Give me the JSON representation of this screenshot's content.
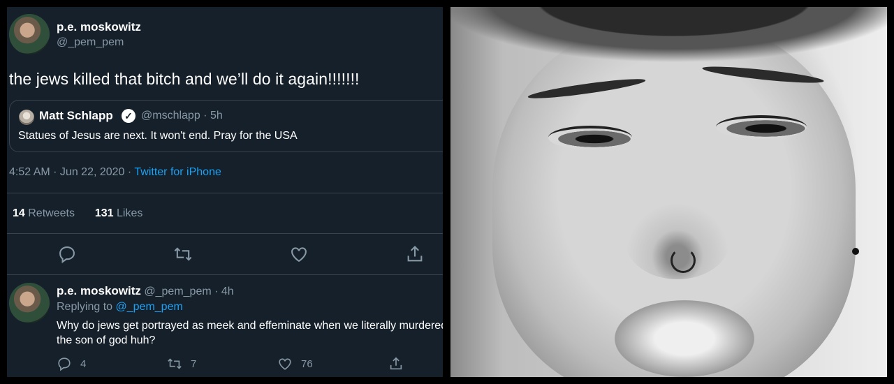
{
  "tweet": {
    "author_name": "p.e. moskowitz",
    "author_handle": "@_pem_pem",
    "text": "the jews killed that bitch and we’ll do it again!!!!!!!",
    "quote": {
      "name": "Matt Schlapp",
      "handle_time": "@mschlapp · 5h",
      "text": "Statues of Jesus are next. It won't end. Pray for the USA"
    },
    "timestamp": "4:52 AM · Jun 22, 2020 · ",
    "source": "Twitter for iPhone",
    "retweets_count": "14",
    "retweets_label": "Retweets",
    "likes_count": "131",
    "likes_label": "Likes"
  },
  "reply": {
    "author_name": "p.e. moskowitz",
    "handle_time": "@_pem_pem · 4h",
    "replying_prefix": "Replying to ",
    "replying_to": "@_pem_pem",
    "text": "Why do jews get portrayed as meek and effeminate when we literally murdered the son of god huh?",
    "replies": "4",
    "retweets": "7",
    "likes": "76"
  },
  "icons": {
    "reply": "reply-icon",
    "retweet": "retweet-icon",
    "like": "heart-icon",
    "share": "share-icon"
  },
  "colors": {
    "background": "#15202b",
    "link": "#1da1f2",
    "secondary_text": "#8899a6"
  }
}
